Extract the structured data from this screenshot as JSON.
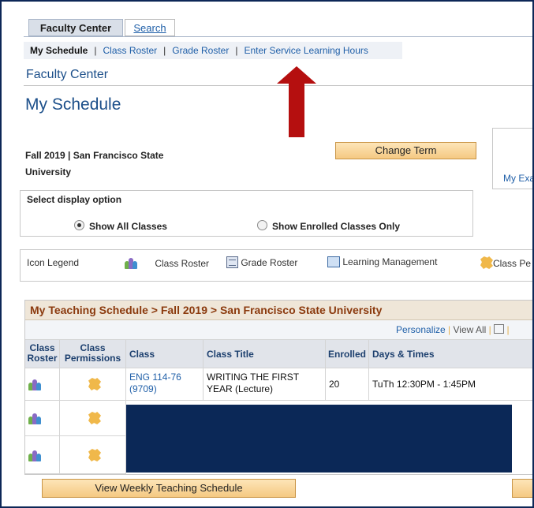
{
  "tabs": [
    {
      "label": "Faculty Center",
      "active": true
    },
    {
      "label": "Search",
      "active": false
    }
  ],
  "subnav": {
    "current": "My Schedule",
    "links": [
      "Class Roster",
      "Grade Roster",
      "Enter Service Learning Hours"
    ],
    "separator": "|"
  },
  "section_title": "Faculty Center",
  "page_title": "My Schedule",
  "term": {
    "line1": "Fall 2019 | San Francisco State",
    "line2": "University",
    "change_term_label": "Change Term"
  },
  "right_panel_link": "My Exa",
  "display_option": {
    "title": "Select display option",
    "options": [
      {
        "label": "Show All Classes",
        "selected": true
      },
      {
        "label": "Show Enrolled Classes Only",
        "selected": false
      }
    ]
  },
  "legend": {
    "title": "Icon Legend",
    "items": [
      {
        "icon": "class-roster-icon",
        "label": "Class Roster"
      },
      {
        "icon": "grade-roster-icon",
        "label": "Grade Roster"
      },
      {
        "icon": "learning-management-icon",
        "label": "Learning Management"
      },
      {
        "icon": "class-permissions-icon",
        "label": "Class Pe"
      }
    ]
  },
  "schedule": {
    "title": "My Teaching Schedule > Fall 2019 > San Francisco State University",
    "toolbar": {
      "personalize": "Personalize",
      "sep": "|",
      "view_all": "View All",
      "sep2": "|"
    },
    "columns": {
      "class_roster": [
        "Class",
        "Roster"
      ],
      "class_permissions": [
        "Class",
        "Permissions"
      ],
      "class": "Class",
      "class_title": "Class Title",
      "enrolled": "Enrolled",
      "days_times": "Days & Times"
    },
    "rows": [
      {
        "class_line1": "ENG 114-76",
        "class_line2": "(9709)",
        "title_line1": "WRITING THE FIRST",
        "title_line2": "YEAR (Lecture)",
        "enrolled": "20",
        "days_times": "TuTh 12:30PM - 1:45PM"
      }
    ]
  },
  "bottom": {
    "weekly_button": "View Weekly Teaching Schedule"
  },
  "colors": {
    "frame": "#0d2757",
    "arrow": "#b50f0f",
    "schedule_title": "#8b3a0e",
    "link": "#1f5fa8",
    "redaction": "#0b2857",
    "button": "#f5c982"
  }
}
